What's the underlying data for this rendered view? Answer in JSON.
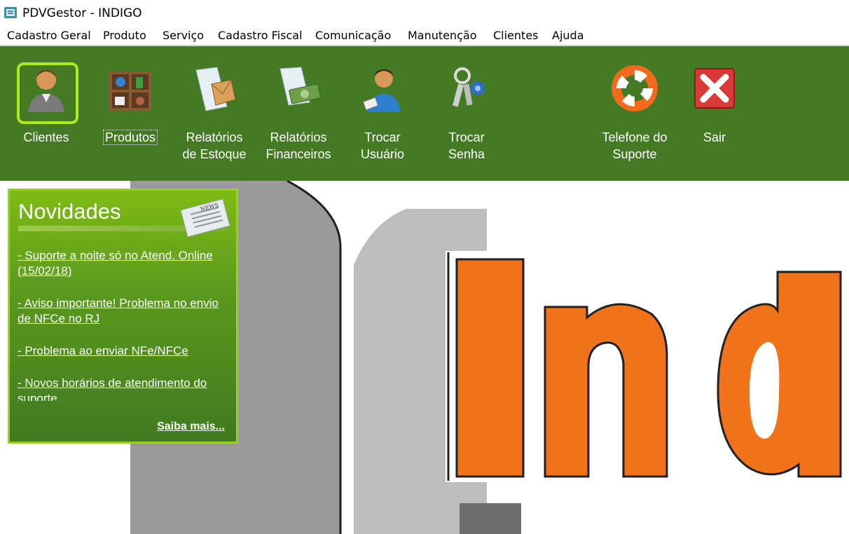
{
  "window": {
    "title": "PDVGestor - INDIGO",
    "icon": "pdvgestor-app-icon"
  },
  "menu": [
    {
      "label": "Cadastro Geral"
    },
    {
      "label": "Produto"
    },
    {
      "label": "Serviço"
    },
    {
      "label": "Cadastro Fiscal"
    },
    {
      "label": "Comunicação"
    },
    {
      "label": "Manutenção"
    },
    {
      "label": "Clientes"
    },
    {
      "label": "Ajuda"
    }
  ],
  "toolbar": {
    "buttons": [
      {
        "label": "Clientes",
        "icon": "person-icon",
        "selected": true
      },
      {
        "label": "Produtos",
        "icon": "shelf-products-icon",
        "focused": true
      },
      {
        "label": "Relatórios\nde Estoque",
        "icon": "package-report-icon"
      },
      {
        "label": "Relatórios\nFinanceiros",
        "icon": "money-report-icon"
      },
      {
        "label": "Trocar\nUsuário",
        "icon": "user-badge-icon"
      },
      {
        "label": "Trocar\nSenha",
        "icon": "keys-icon"
      },
      {
        "label": "Telefone do\nSuporte",
        "icon": "lifebuoy-icon"
      },
      {
        "label": "Sair",
        "icon": "close-x-icon"
      }
    ],
    "colors": {
      "background": "#447a24",
      "selection": "#aeea16"
    }
  },
  "news": {
    "title": "Novidades",
    "icon": "newspaper-icon",
    "items": [
      "- Suporte a noite só no Atend. Online (15/02/18)",
      "- Aviso importante! Problema no envio de NFCe no RJ",
      "- Problema ao enviar NFe/NFCe",
      "- Novos horários de atendimento do suporte"
    ],
    "more": "Saiba mais...",
    "newspaper_text": "NEWS"
  },
  "logo": {
    "text": "Ind",
    "colors": {
      "orange": "#f0731c",
      "gray": "#9a9a9a",
      "light_gray": "#bdbdbd"
    }
  }
}
